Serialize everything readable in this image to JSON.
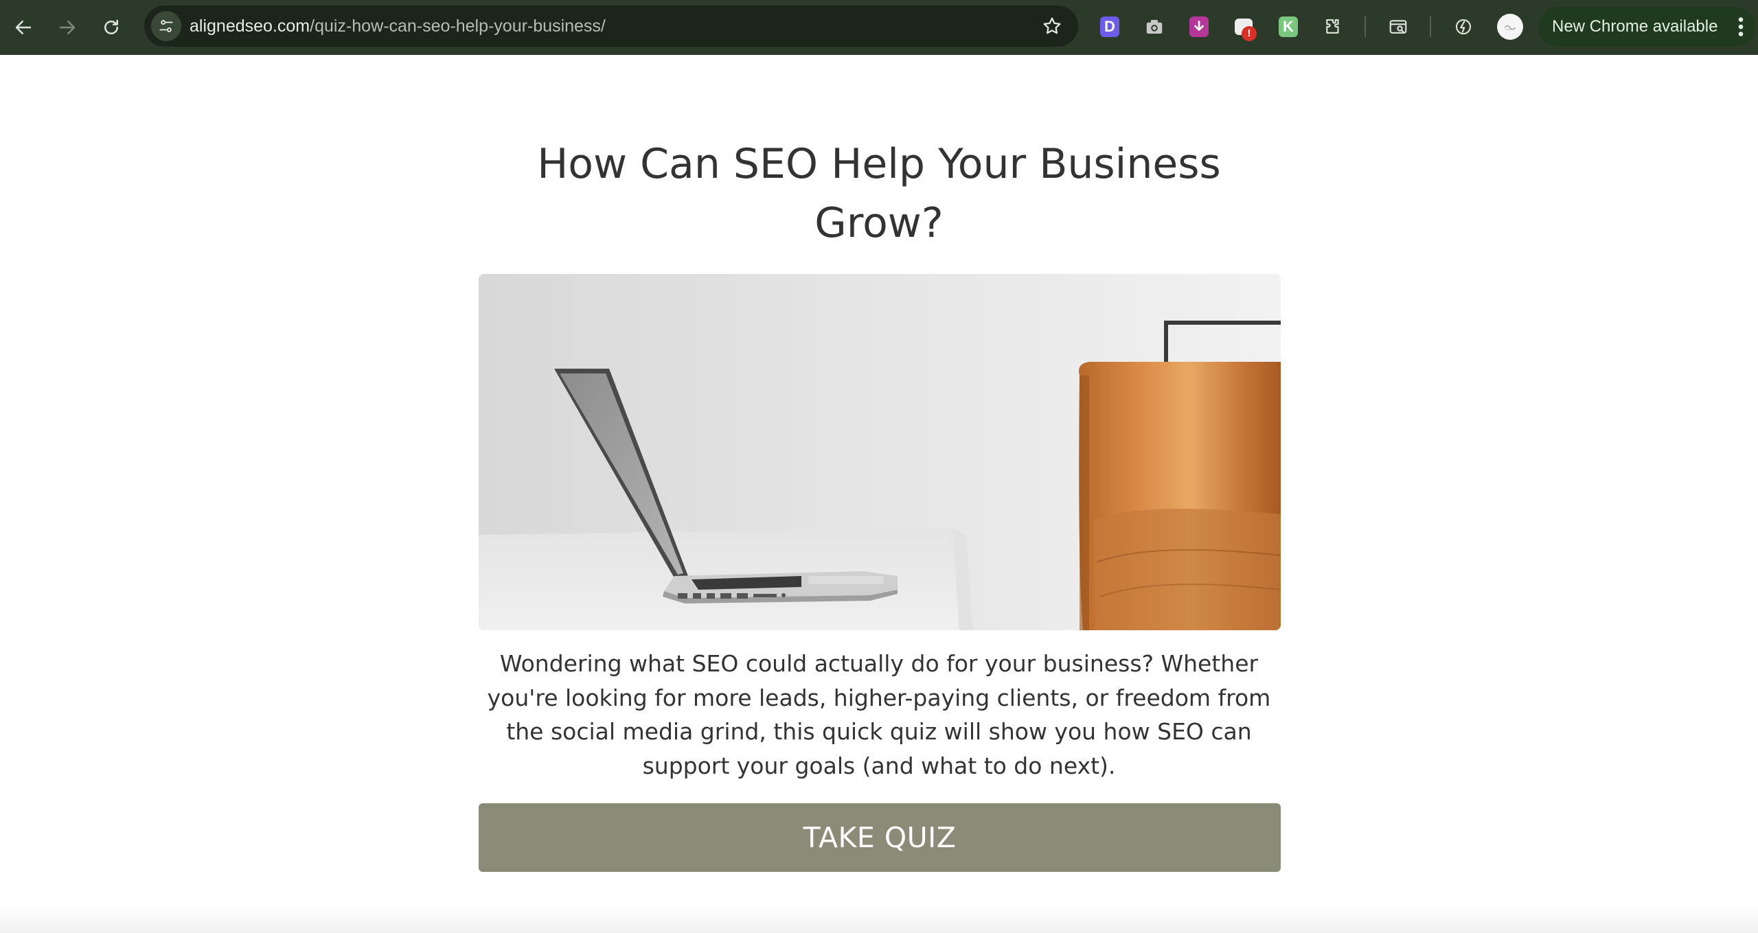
{
  "browser": {
    "url_domain": "alignedseo.com",
    "url_path": "/quiz-how-can-seo-help-your-business/",
    "update_label": "New Chrome available",
    "extensions": [
      {
        "name": "dashlane-extension",
        "letter": "D",
        "color": "#6c5ce7"
      },
      {
        "name": "screenshot-extension",
        "color": "#c8c8c8"
      },
      {
        "name": "downloader-extension",
        "color": "#b5379a"
      },
      {
        "name": "alert-extension",
        "color": "#eeeeee",
        "badge": "!"
      },
      {
        "name": "keyword-extension",
        "letter": "K",
        "color": "#7bc67e"
      }
    ],
    "icons": {
      "back": "arrow-left-icon",
      "forward": "arrow-right-icon",
      "reload": "reload-icon",
      "site_info": "tune-icon",
      "bookmark": "star-icon",
      "puzzle": "extensions-icon",
      "tab_search": "tab-search-icon",
      "performance": "speed-icon"
    },
    "badge_color": "#d93025"
  },
  "page": {
    "title": "How Can SEO Help Your Business Grow?",
    "description": "Wondering what SEO could actually do for your business? Whether you're looking for more leads, higher-paying clients, or freedom from the social media grind, this quick quiz will show you how SEO can support your goals (and what to do next).",
    "cta_label": "TAKE QUIZ",
    "cta_color": "#8a8c78",
    "hero_image": "laptop-and-leather-chair-photo"
  }
}
